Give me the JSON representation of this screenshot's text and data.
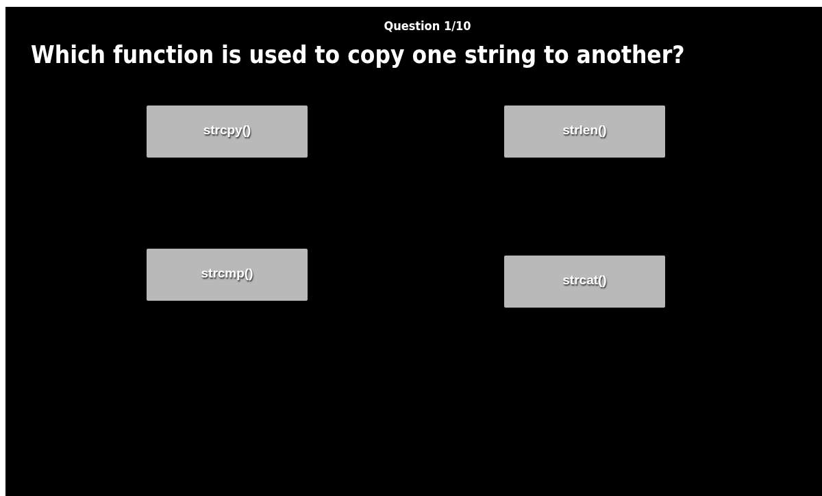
{
  "progress": "Question 1/10",
  "question": "Which function is used to copy one string to another?",
  "answers": [
    {
      "label": "strcpy()"
    },
    {
      "label": "strlen()"
    },
    {
      "label": "strcmp()"
    },
    {
      "label": "strcat()"
    }
  ]
}
